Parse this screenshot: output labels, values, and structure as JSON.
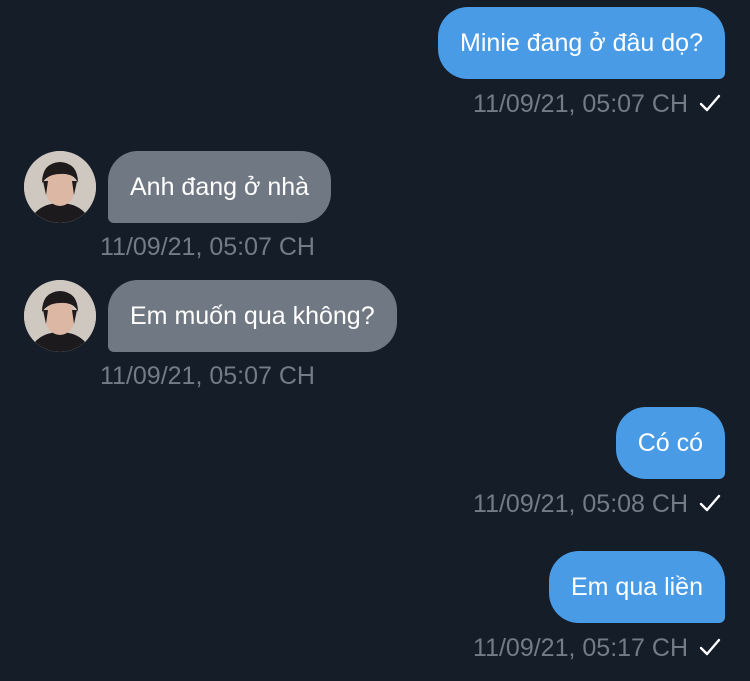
{
  "messages": [
    {
      "id": "msg-1",
      "direction": "outgoing",
      "text": "Minie đang ở đâu dọ?",
      "timestamp": "11/09/21, 05:07 CH",
      "status_icon": "checkmark-icon"
    },
    {
      "id": "msg-2",
      "direction": "incoming",
      "avatar_icon": "contact-avatar",
      "text": "Anh đang ở nhà",
      "timestamp": "11/09/21, 05:07 CH"
    },
    {
      "id": "msg-3",
      "direction": "incoming",
      "avatar_icon": "contact-avatar",
      "text": "Em muốn qua không?",
      "timestamp": "11/09/21, 05:07 CH"
    },
    {
      "id": "msg-4",
      "direction": "outgoing",
      "text": "Có có",
      "timestamp": "11/09/21, 05:08 CH",
      "status_icon": "checkmark-icon"
    },
    {
      "id": "msg-5",
      "direction": "outgoing",
      "text": "Em qua liền",
      "timestamp": "11/09/21, 05:17 CH",
      "status_icon": "checkmark-icon"
    }
  ],
  "colors": {
    "background": "#151d28",
    "outgoing_bubble": "#4a9be6",
    "incoming_bubble": "#707983",
    "timestamp_text": "#737c86",
    "message_text": "#ffffff"
  }
}
